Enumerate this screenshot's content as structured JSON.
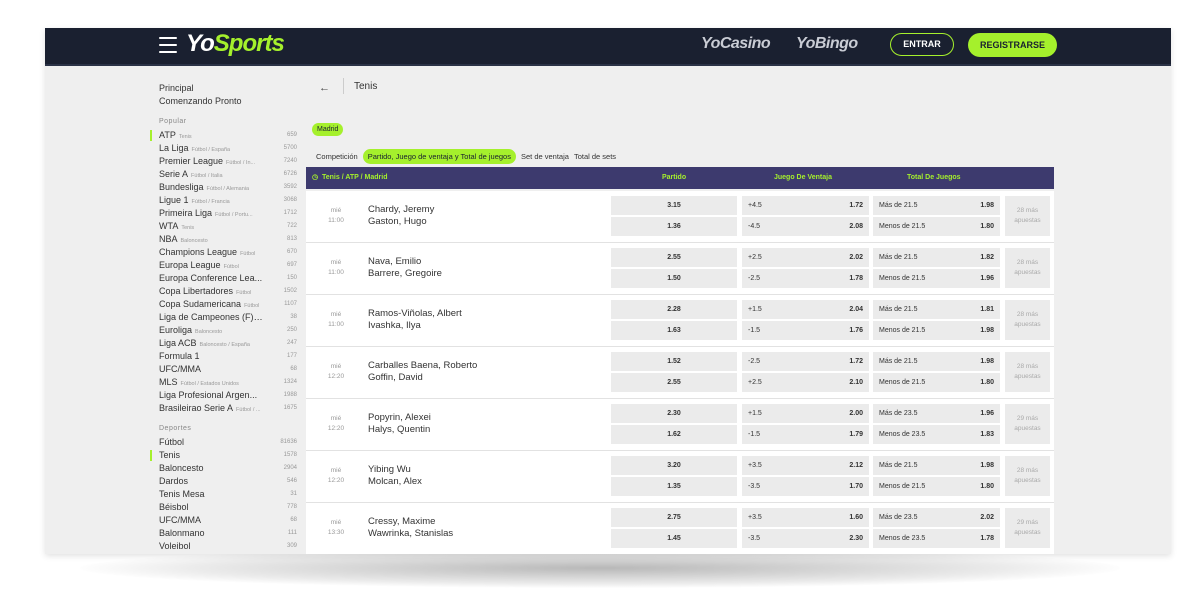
{
  "header": {
    "logo_main": "Yo",
    "logo_accent": "Sports",
    "casino_label": "YoCasino",
    "bingo_label": "YoBingo",
    "login_label": "ENTRAR",
    "register_label": "REGISTRARSE",
    "colors": {
      "bar": "#1a2030",
      "accent": "#a5f02c"
    }
  },
  "sidebar": {
    "links": [
      "Principal",
      "Comenzando Pronto"
    ],
    "popular_title": "Popular",
    "popular": [
      {
        "name": "ATP",
        "sub": "Tenis",
        "count": "659",
        "active": true
      },
      {
        "name": "La Liga",
        "sub": "Fútbol / España",
        "count": "5700"
      },
      {
        "name": "Premier League",
        "sub": "Fútbol / In...",
        "count": "7240"
      },
      {
        "name": "Serie A",
        "sub": "Fútbol / Italia",
        "count": "6726"
      },
      {
        "name": "Bundesliga",
        "sub": "Fútbol / Alemania",
        "count": "3592"
      },
      {
        "name": "Ligue 1",
        "sub": "Fútbol / Francia",
        "count": "3068"
      },
      {
        "name": "Primeira Liga",
        "sub": "Fútbol / Portu...",
        "count": "1712"
      },
      {
        "name": "WTA",
        "sub": "Tenis",
        "count": "722"
      },
      {
        "name": "NBA",
        "sub": "Baloncesto",
        "count": "813"
      },
      {
        "name": "Champions League",
        "sub": "Fútbol",
        "count": "670"
      },
      {
        "name": "Europa League",
        "sub": "Fútbol",
        "count": "697"
      },
      {
        "name": "Europa Conference Lea...",
        "sub": "",
        "count": "150"
      },
      {
        "name": "Copa Libertadores",
        "sub": "Fútbol",
        "count": "1502"
      },
      {
        "name": "Copa Sudamericana",
        "sub": "Fútbol",
        "count": "1107"
      },
      {
        "name": "Liga de Campeones (F)",
        "sub": "Fú...",
        "count": "38"
      },
      {
        "name": "Euroliga",
        "sub": "Baloncesto",
        "count": "250"
      },
      {
        "name": "Liga ACB",
        "sub": "Baloncesto / España",
        "count": "247"
      },
      {
        "name": "Formula 1",
        "sub": "",
        "count": "177"
      },
      {
        "name": "UFC/MMA",
        "sub": "",
        "count": "68"
      },
      {
        "name": "MLS",
        "sub": "Fútbol / Estados Unidos",
        "count": "1324"
      },
      {
        "name": "Liga Profesional Argen...",
        "sub": "",
        "count": "1988"
      },
      {
        "name": "Brasileirao Serie A",
        "sub": "Fútbol / ...",
        "count": "1675"
      }
    ],
    "sports_title": "Deportes",
    "sports": [
      {
        "name": "Fútbol",
        "count": "81636"
      },
      {
        "name": "Tenis",
        "count": "1578",
        "active": true
      },
      {
        "name": "Baloncesto",
        "count": "2904"
      },
      {
        "name": "Dardos",
        "count": "546"
      },
      {
        "name": "Tenis Mesa",
        "count": "31"
      },
      {
        "name": "Béisbol",
        "count": "778"
      },
      {
        "name": "UFC/MMA",
        "count": "68"
      },
      {
        "name": "Balonmano",
        "count": "111"
      },
      {
        "name": "Voleibol",
        "count": "309"
      }
    ]
  },
  "main": {
    "back_icon": "←",
    "title": "Tenis",
    "chip": "Madrid",
    "tabs": [
      "Competición",
      "Partido, Juego de ventaja y Total de juegos",
      "Set de ventaja",
      "Total de sets"
    ],
    "active_tab": 1,
    "breadcrumb": "Tenis / ATP / Madrid",
    "col_match": "Partido",
    "col_handicap": "Juego De Ventaja",
    "col_total": "Total De Juegos"
  },
  "matches": [
    {
      "day": "mié",
      "time": "11:00",
      "p1": "Chardy, Jeremy",
      "p2": "Gaston, Hugo",
      "o1": "3.15",
      "o2": "1.36",
      "h1l": "+4.5",
      "h1v": "1.72",
      "h2l": "-4.5",
      "h2v": "2.08",
      "t1l": "Más de 21.5",
      "t1v": "1.98",
      "t2l": "Menos de 21.5",
      "t2v": "1.80",
      "more": "28 más",
      "more2": "apuestas"
    },
    {
      "day": "mié",
      "time": "11:00",
      "p1": "Nava, Emilio",
      "p2": "Barrere, Gregoire",
      "o1": "2.55",
      "o2": "1.50",
      "h1l": "+2.5",
      "h1v": "2.02",
      "h2l": "-2.5",
      "h2v": "1.78",
      "t1l": "Más de 21.5",
      "t1v": "1.82",
      "t2l": "Menos de 21.5",
      "t2v": "1.96",
      "more": "28 más",
      "more2": "apuestas"
    },
    {
      "day": "mié",
      "time": "11:00",
      "p1": "Ramos-Viñolas, Albert",
      "p2": "Ivashka, Ilya",
      "o1": "2.28",
      "o2": "1.63",
      "h1l": "+1.5",
      "h1v": "2.04",
      "h2l": "-1.5",
      "h2v": "1.76",
      "t1l": "Más de 21.5",
      "t1v": "1.81",
      "t2l": "Menos de 21.5",
      "t2v": "1.98",
      "more": "28 más",
      "more2": "apuestas"
    },
    {
      "day": "mié",
      "time": "12:20",
      "p1": "Carballes Baena, Roberto",
      "p2": "Goffin, David",
      "o1": "1.52",
      "o2": "2.55",
      "h1l": "-2.5",
      "h1v": "1.72",
      "h2l": "+2.5",
      "h2v": "2.10",
      "t1l": "Más de 21.5",
      "t1v": "1.98",
      "t2l": "Menos de 21.5",
      "t2v": "1.80",
      "more": "28 más",
      "more2": "apuestas"
    },
    {
      "day": "mié",
      "time": "12:20",
      "p1": "Popyrin, Alexei",
      "p2": "Halys, Quentin",
      "o1": "2.30",
      "o2": "1.62",
      "h1l": "+1.5",
      "h1v": "2.00",
      "h2l": "-1.5",
      "h2v": "1.79",
      "t1l": "Más de 23.5",
      "t1v": "1.96",
      "t2l": "Menos de 23.5",
      "t2v": "1.83",
      "more": "29 más",
      "more2": "apuestas"
    },
    {
      "day": "mié",
      "time": "12:20",
      "p1": "Yibing Wu",
      "p2": "Molcan, Alex",
      "o1": "3.20",
      "o2": "1.35",
      "h1l": "+3.5",
      "h1v": "2.12",
      "h2l": "-3.5",
      "h2v": "1.70",
      "t1l": "Más de 21.5",
      "t1v": "1.98",
      "t2l": "Menos de 21.5",
      "t2v": "1.80",
      "more": "28 más",
      "more2": "apuestas"
    },
    {
      "day": "mié",
      "time": "13:30",
      "p1": "Cressy, Maxime",
      "p2": "Wawrinka, Stanislas",
      "o1": "2.75",
      "o2": "1.45",
      "h1l": "+3.5",
      "h1v": "1.60",
      "h2l": "-3.5",
      "h2v": "2.30",
      "t1l": "Más de 23.5",
      "t1v": "2.02",
      "t2l": "Menos de 23.5",
      "t2v": "1.78",
      "more": "29 más",
      "more2": "apuestas"
    }
  ]
}
